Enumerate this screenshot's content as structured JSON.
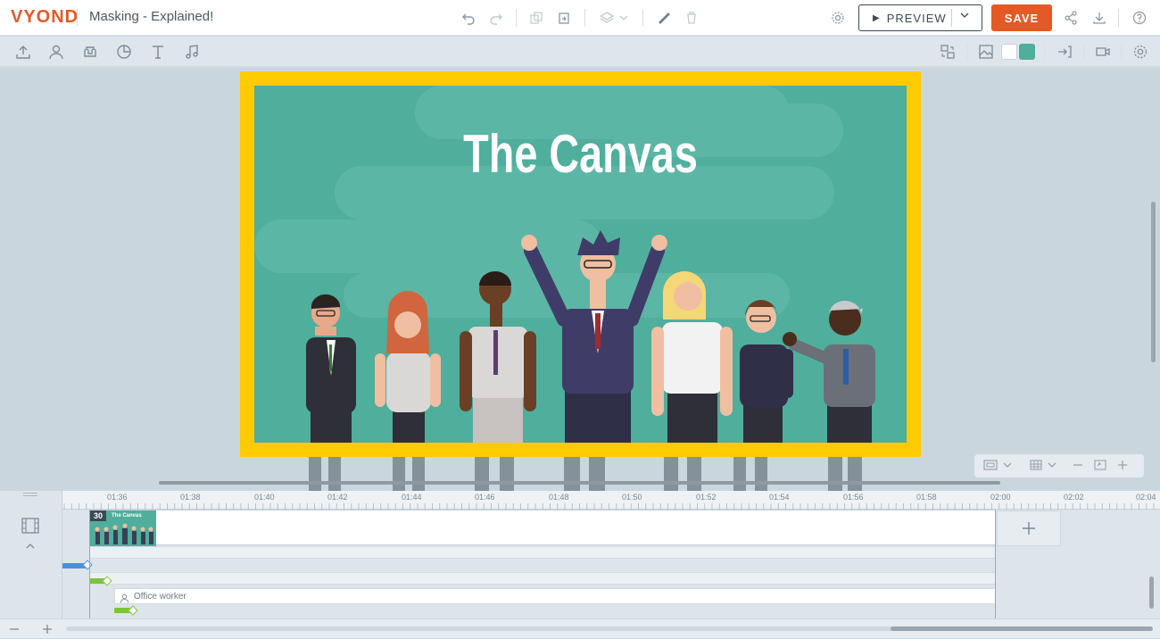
{
  "app": {
    "logo": "VYOND",
    "title": "Masking - Explained!"
  },
  "toolbar": {
    "preview_label": "PREVIEW",
    "save_label": "SAVE"
  },
  "canvas": {
    "scene_title": "The Canvas",
    "frame_color": "#fecb00",
    "background_color": "#4fae9c"
  },
  "colors": {
    "accent": "#e35a26",
    "swatch_primary": "#ffffff",
    "swatch_secondary": "#4fae9c"
  },
  "timeline": {
    "ticks": [
      "01:36",
      "01:38",
      "01:40",
      "01:42",
      "01:44",
      "01:46",
      "01:48",
      "01:50",
      "01:52",
      "01:54",
      "01:56",
      "01:58",
      "02:00",
      "02:02",
      "02:04"
    ],
    "scene_number": "30",
    "scene_thumb_title": "The Canvas",
    "track_label": "Office worker"
  }
}
